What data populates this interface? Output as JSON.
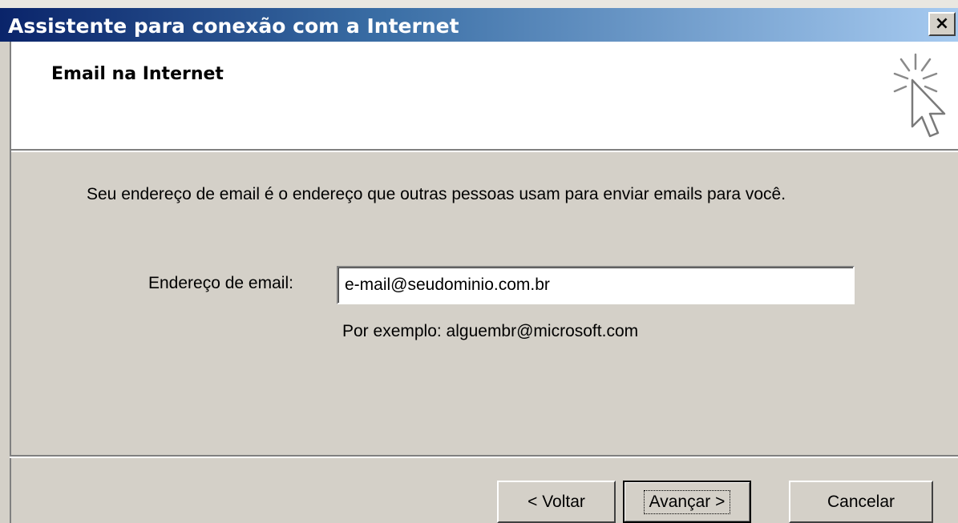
{
  "window": {
    "title": "Assistente para conexão com a Internet",
    "close_glyph": "×"
  },
  "header": {
    "title": "Email na Internet",
    "icon": "wizard-cursor-sparkle-icon"
  },
  "body": {
    "description": "Seu endereço de email é o endereço que outras pessoas usam para enviar emails para você.",
    "email_label": "Endereço de email:",
    "email_value": "e-mail@seudominio.com.br",
    "example": "Por exemplo: alguembr@microsoft.com"
  },
  "buttons": {
    "back": "< Voltar",
    "next": "Avançar >",
    "cancel": "Cancelar"
  }
}
